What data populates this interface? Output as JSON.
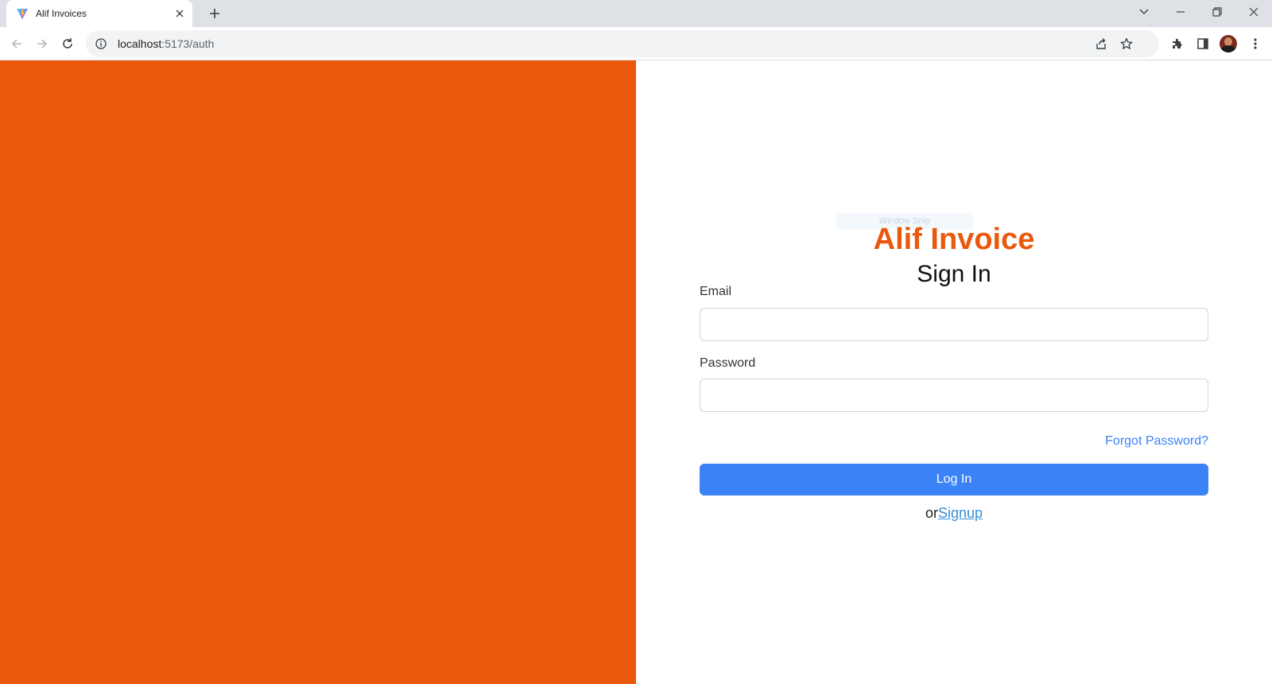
{
  "browser": {
    "tab_title": "Alif Invoices",
    "new_tab": "+",
    "url_host": "localhost",
    "url_path": ":5173/auth"
  },
  "colors": {
    "brand_orange": "#ea580c",
    "primary_blue": "#3b82f6",
    "link_blue": "#3b82f6",
    "signup_link": "#3a8fd6"
  },
  "overlay": {
    "snip_text": "Window Snip"
  },
  "auth": {
    "brand": "Alif Invoice",
    "heading": "Sign In",
    "email_label": "Email",
    "email_value": "",
    "password_label": "Password",
    "password_value": "",
    "forgot_link": "Forgot Password?",
    "login_button": "Log In",
    "or_text": "or",
    "signup_link": "Signup"
  }
}
